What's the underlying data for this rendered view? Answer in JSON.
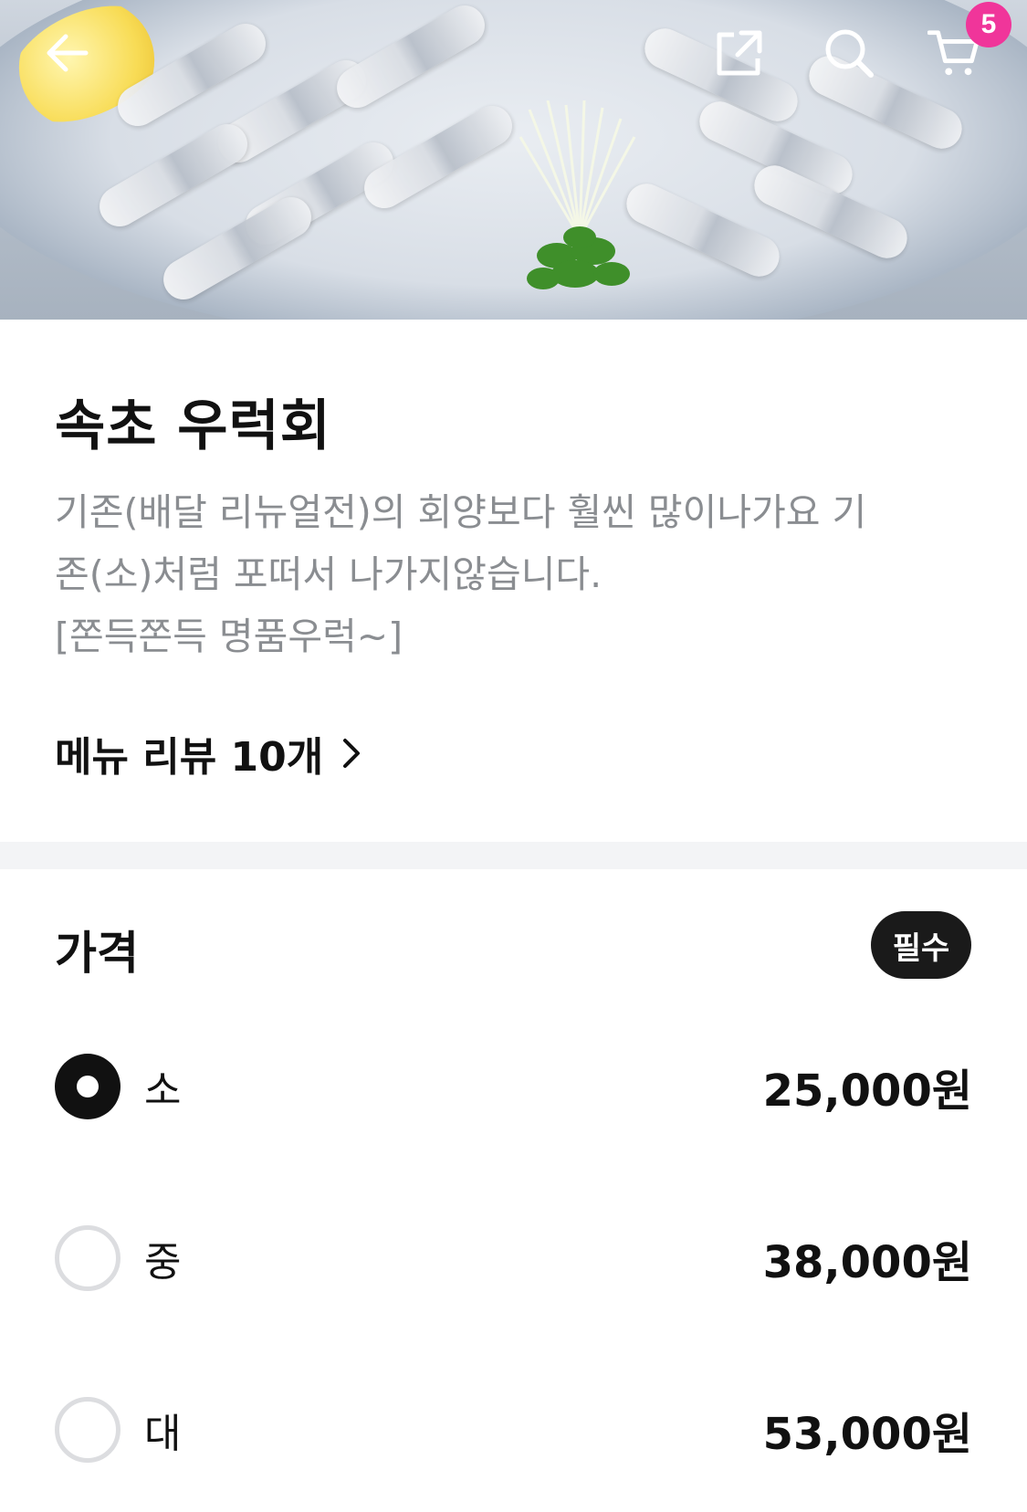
{
  "header": {
    "back_icon": "arrow-left-icon",
    "share_icon": "share-external-icon",
    "search_icon": "search-icon",
    "cart_icon": "cart-icon",
    "cart_count": "5"
  },
  "product": {
    "title": "속초 우럭회",
    "description_line1": "기존(배달 리뉴얼전)의 회양보다 훨씬 많이나가요 기",
    "description_line2": "존(소)처럼 포떠서 나가지않습니다.",
    "description_line3": "[쫀득쫀득 명품우럭~]",
    "review_link": "메뉴 리뷰 10개"
  },
  "price_section": {
    "title": "가격",
    "required_badge": "필수",
    "options": [
      {
        "label": "소",
        "price": "25,000원",
        "selected": true
      },
      {
        "label": "중",
        "price": "38,000원",
        "selected": false
      },
      {
        "label": "대",
        "price": "53,000원",
        "selected": false
      }
    ]
  },
  "colors": {
    "badge": "#f0359a",
    "text_primary": "#111111",
    "text_secondary": "#8a8d91",
    "divider": "#f3f4f6"
  }
}
